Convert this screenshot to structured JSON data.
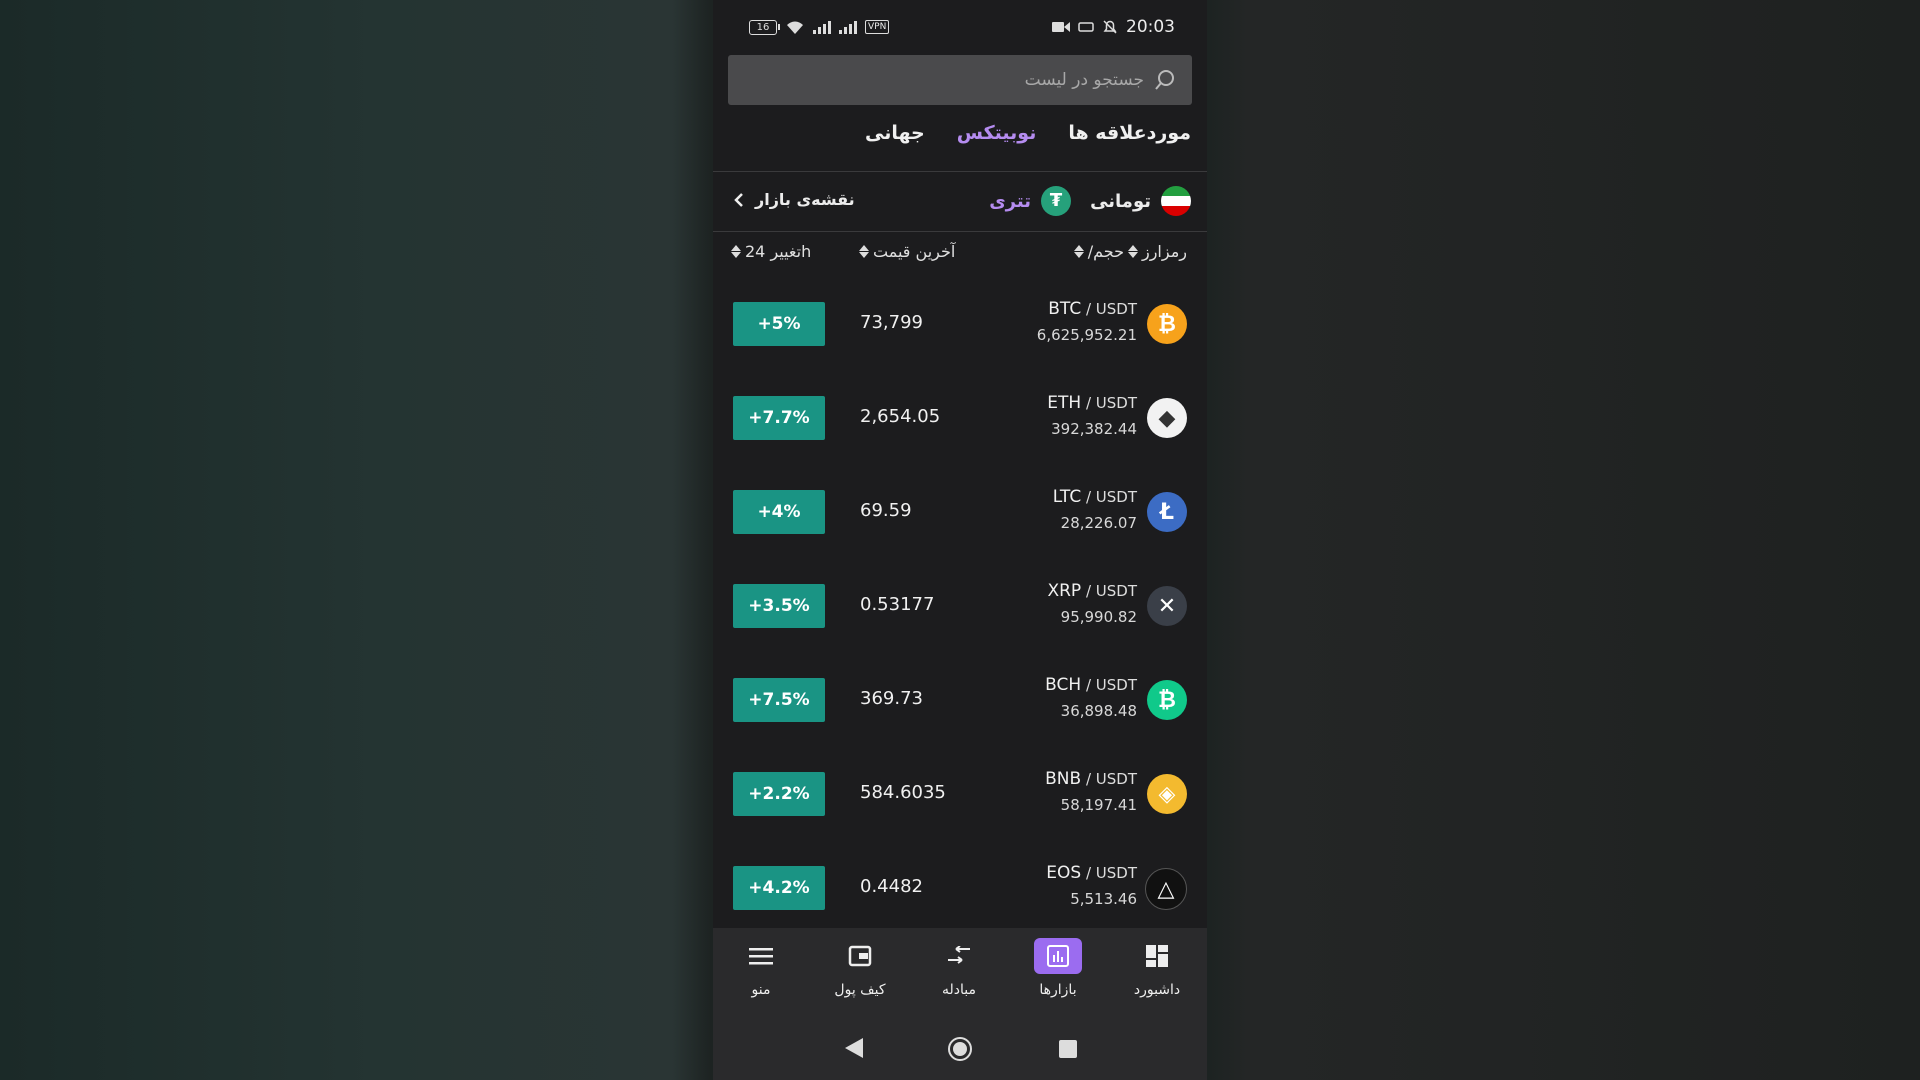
{
  "status_bar": {
    "battery": "16",
    "vpn": "VPN",
    "time": "20:03"
  },
  "search": {
    "placeholder": "جستجو در لیست"
  },
  "tabs": [
    {
      "label": "موردعلاقه ها"
    },
    {
      "label": "نوبیتکس"
    },
    {
      "label": "جهانی"
    }
  ],
  "quote": {
    "toman": "تومانی",
    "tether": "تتری",
    "tether_symbol": "₮",
    "market_map": "نقشه‌ی بازار"
  },
  "headers": {
    "coin": "رمزارز",
    "volume": "/حجم",
    "last_price": "آخرین قیمت",
    "change": "تغییر 24h"
  },
  "rows": [
    {
      "base": "BTC",
      "quote": " / USDT",
      "volume": "6,625,952.21",
      "price": "73,799",
      "change": "+5%",
      "icon": "bitcoin-icon",
      "icon_glyph": "₿",
      "color": "#f7a21b"
    },
    {
      "base": "ETH",
      "quote": " / USDT",
      "volume": "392,382.44",
      "price": "2,654.05",
      "change": "+7.7%",
      "icon": "ethereum-icon",
      "icon_glyph": "◆",
      "color": "#f2f2f2"
    },
    {
      "base": "LTC",
      "quote": " / USDT",
      "volume": "28,226.07",
      "price": "69.59",
      "change": "+4%",
      "icon": "litecoin-icon",
      "icon_glyph": "Ł",
      "color": "#3c6cc4"
    },
    {
      "base": "XRP",
      "quote": " / USDT",
      "volume": "95,990.82",
      "price": "0.53177",
      "change": "+3.5%",
      "icon": "xrp-icon",
      "icon_glyph": "✕",
      "color": "#3a3f48"
    },
    {
      "base": "BCH",
      "quote": " / USDT",
      "volume": "36,898.48",
      "price": "369.73",
      "change": "+7.5%",
      "icon": "bitcoin-cash-icon",
      "icon_glyph": "₿",
      "color": "#10c98a"
    },
    {
      "base": "BNB",
      "quote": " / USDT",
      "volume": "58,197.41",
      "price": "584.6035",
      "change": "+2.2%",
      "icon": "bnb-icon",
      "icon_glyph": "◈",
      "color": "#f3ba2f"
    },
    {
      "base": "EOS",
      "quote": " / USDT",
      "volume": "5,513.46",
      "price": "0.4482",
      "change": "+4.2%",
      "icon": "eos-icon",
      "icon_glyph": "△",
      "color": "#111111"
    }
  ],
  "bottom_nav": [
    {
      "label": "منو",
      "icon": "menu-icon"
    },
    {
      "label": "کیف پول",
      "icon": "wallet-icon"
    },
    {
      "label": "مبادله",
      "icon": "exchange-icon"
    },
    {
      "label": "بازارها",
      "icon": "markets-icon"
    },
    {
      "label": "داشبورد",
      "icon": "dashboard-icon"
    }
  ],
  "colors": {
    "accent": "#b58cf0",
    "active_nav": "#9b6cf0",
    "change_bg": "#1a9484"
  }
}
